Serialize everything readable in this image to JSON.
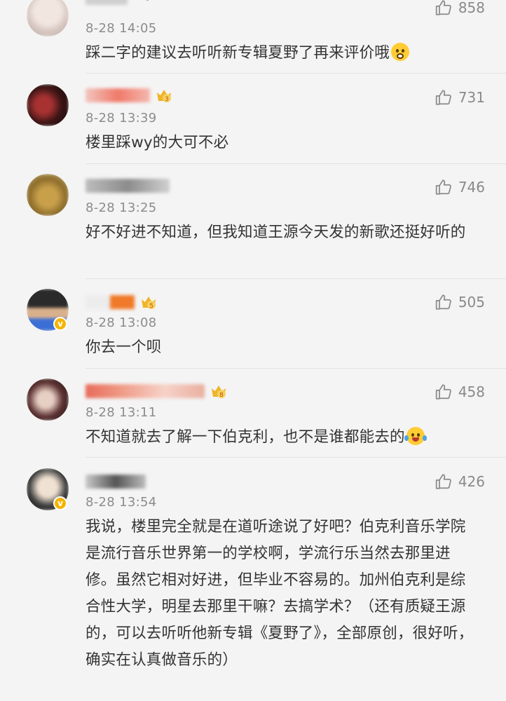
{
  "comments": [
    {
      "time": "8-28 14:05",
      "text": "踩二字的建议去听听新专辑夏野了再来评价哦",
      "emoji": "scared-face",
      "likes": "858",
      "name": "",
      "verified": false
    },
    {
      "time": "8-28 13:39",
      "text": "楼里踩wy的大可不必",
      "likes": "731",
      "name": "",
      "badge": "3",
      "verified": false
    },
    {
      "time": "8-28 13:25",
      "text": "好不好进不知道，但我知道王源今天发的新歌还挺好听的",
      "likes": "746",
      "name": "",
      "verified": false
    },
    {
      "time": "8-28 13:08",
      "text": "你去一个呗",
      "likes": "505",
      "name": "",
      "badge": "5",
      "verified": true
    },
    {
      "time": "8-28 13:11",
      "text": "不知道就去了解一下伯克利，也不是谁都能去的",
      "emoji": "laugh-cry",
      "likes": "458",
      "name": "",
      "badge": "8",
      "verified": false
    },
    {
      "time": "8-28 13:54",
      "text": "我说，楼里完全就是在道听途说了好吧？伯克利音乐学院是流行音乐世界第一的学校啊，学流行乐当然去那里进修。虽然它相对好进，但毕业不容易的。加州伯克利是综合性大学，明星去那里干嘛？去搞学术？（还有质疑王源的，可以去听听他新专辑《夏野了》，全部原创，很好听，确实在认真做音乐的）",
      "likes": "426",
      "name": "",
      "verified": true
    }
  ],
  "colors": {
    "background": "#f4f4f4",
    "text": "#333333",
    "meta": "#8c8c8c",
    "verified": "#f5b400",
    "badge": "#f0b429"
  }
}
